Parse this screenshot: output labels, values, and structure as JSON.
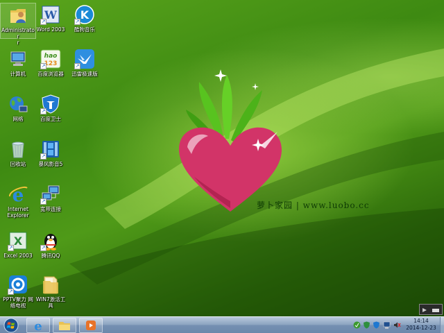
{
  "desktop": {
    "icons": [
      {
        "label": "Administrator",
        "label2": "r"
      },
      {
        "label": "Word 2003"
      },
      {
        "label": "酷狗音乐"
      },
      {
        "label": "计算机"
      },
      {
        "label": "百度浏览器"
      },
      {
        "label": "迅雷极速版"
      },
      {
        "label": "网络"
      },
      {
        "label": "百度卫士"
      },
      {
        "label": "回收站"
      },
      {
        "label": "暴风影音5"
      },
      {
        "label": "Internet",
        "label2": "Explorer"
      },
      {
        "label": "宽带连接"
      },
      {
        "label": "Excel 2003"
      },
      {
        "label": "腾讯QQ"
      },
      {
        "label": "PPTV聚力 网",
        "label2": "络电视"
      },
      {
        "label": "WIN7激活工",
        "label2": "具"
      }
    ],
    "brand_text": "萝卜家园 | www.luobo.cc",
    "hao_text": "hao",
    "hao_num": "123",
    "kugou_letter": "K",
    "word_letter": "W",
    "excel_letter": "X"
  },
  "taskbar": {
    "time": "14:14",
    "date": "2014-12-23"
  },
  "colors": {
    "accent_blue": "#1d5fbf",
    "radish_pink": "#d8336e",
    "leaf_green": "#4cc21c"
  }
}
